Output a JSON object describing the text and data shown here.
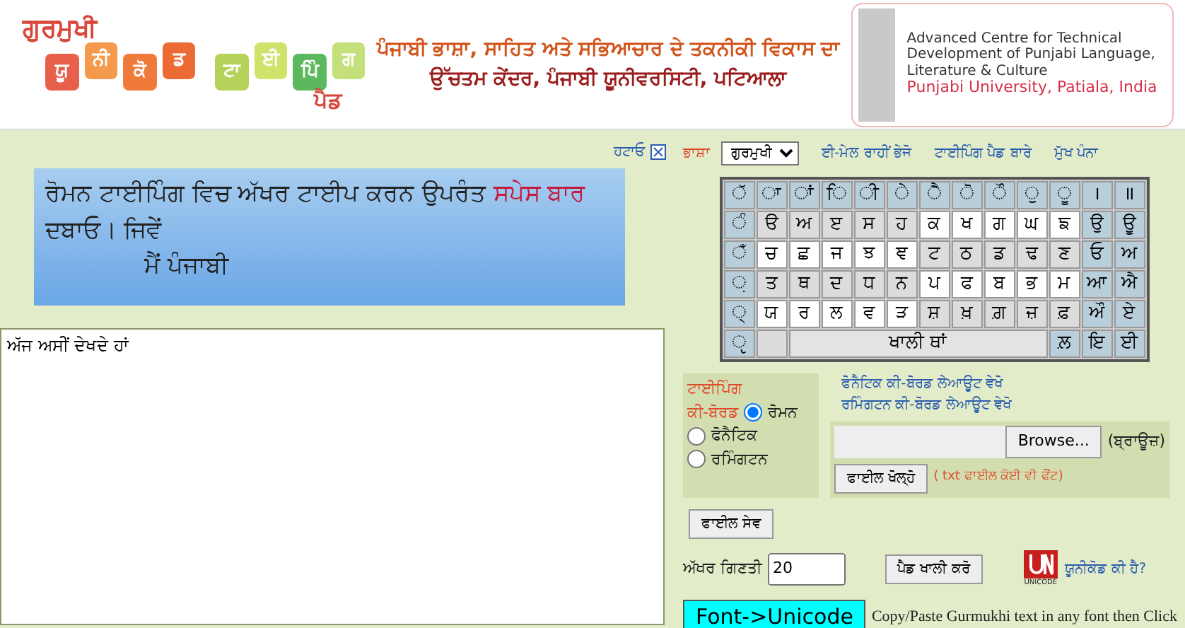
{
  "header": {
    "logo_title": "ਗੁਰਮੁਖੀ",
    "logo_tiles": [
      {
        "label": "ਯੂ",
        "color": "#e8604c"
      },
      {
        "label": "ਨੀ",
        "color": "#f39a4c"
      },
      {
        "label": "ਕੋ",
        "color": "#f07a3a"
      },
      {
        "label": "ਡ",
        "color": "#ec6a34"
      },
      {
        "label": "ਟਾ",
        "color": "#b5d35a"
      },
      {
        "label": "ਈ",
        "color": "#cfe36a"
      },
      {
        "label": "ਪਿੰ",
        "color": "#5cb85c"
      },
      {
        "label": "ਗ",
        "color": "#c4e07a"
      }
    ],
    "logo_subtitle": "ਪੈਡ",
    "tagline": [
      "ਪੰਜਾਬੀ ਭਾਸ਼ਾ, ਸਾਹਿਤ ਅਤੇ ਸਭਿਆਚਾਰ ਦੇ ਤਕਨੀਕੀ ਵਿਕਾਸ ਦਾ",
      "ਉੱਚਤਮ ਕੇਂਦਰ, ਪੰਜਾਬੀ ਯੂਨੀਵਰਸਿਟੀ, ਪਟਿਆਲਾ"
    ],
    "centre": {
      "name": "Advanced Centre for Technical Development of Punjabi Language, Literature & Culture",
      "university": "Punjabi University, Patiala, India"
    }
  },
  "remove_link": "ਹਟਾਓ",
  "banner": {
    "text": "ਰੋਮਨ ਟਾਈਪਿੰਗ ਵਿਚ ਅੱਖਰ ਟਾਈਪ ਕਰਨ ਉਪਰੰਤ",
    "highlight": "ਸਪੇਸ ਬਾਰ",
    "text_end": "ਦਬਾਓ। ਜਿਵੇਂ",
    "example": "ਮੈਂ ਪੰਜਾਬੀ"
  },
  "editor": {
    "value": "ਅੱਜ ਅਸੀਂ ਦੇਖਦੇ ਹਾਂ"
  },
  "language": {
    "label": "ਭਾਸ਼ਾ",
    "value": "ਗੁਰਮੁਖੀ"
  },
  "nav_links": [
    "ਈ-ਮੇਲ ਰਾਹੀਂ ਭੇਜੋ",
    "ਟਾਈਪਿੰਗ ਪੈਡ ਬਾਰੇ",
    "ਮੁੱਖ ਪੰਨਾ"
  ],
  "keyboard": [
    [
      {
        "label": "ੱ",
        "kind": "sign"
      },
      {
        "label": "ਾ",
        "kind": "sign"
      },
      {
        "label": "ਾਂ",
        "kind": "sign"
      },
      {
        "label": "ਿ",
        "kind": "sign"
      },
      {
        "label": "ੀ",
        "kind": "sign"
      },
      {
        "label": "ੇ",
        "kind": "sign"
      },
      {
        "label": "ੈ",
        "kind": "sign"
      },
      {
        "label": "ੋ",
        "kind": "sign"
      },
      {
        "label": "ੌ",
        "kind": "sign"
      },
      {
        "label": "ੁ",
        "kind": "sign"
      },
      {
        "label": "ੂ",
        "kind": "sign"
      },
      {
        "label": "।",
        "kind": "sign"
      },
      {
        "label": "॥",
        "kind": "sign"
      }
    ],
    [
      {
        "label": "ੰ",
        "kind": "sign"
      },
      {
        "label": "ੳ",
        "kind": "shaded"
      },
      {
        "label": "ਅ",
        "kind": "shaded"
      },
      {
        "label": "ੲ",
        "kind": "shaded"
      },
      {
        "label": "ਸ",
        "kind": "shaded"
      },
      {
        "label": "ਹ",
        "kind": "shaded"
      },
      {
        "label": "ਕ",
        "kind": "plain"
      },
      {
        "label": "ਖ",
        "kind": "plain"
      },
      {
        "label": "ਗ",
        "kind": "plain"
      },
      {
        "label": "ਘ",
        "kind": "plain"
      },
      {
        "label": "ਙ",
        "kind": "plain"
      },
      {
        "label": "ਉ",
        "kind": "sign"
      },
      {
        "label": "ਊ",
        "kind": "sign"
      }
    ],
    [
      {
        "label": "ਁ",
        "kind": "sign"
      },
      {
        "label": "ਚ",
        "kind": "plain"
      },
      {
        "label": "ਛ",
        "kind": "plain"
      },
      {
        "label": "ਜ",
        "kind": "plain"
      },
      {
        "label": "ਝ",
        "kind": "plain"
      },
      {
        "label": "ਞ",
        "kind": "plain"
      },
      {
        "label": "ਟ",
        "kind": "shaded"
      },
      {
        "label": "ਠ",
        "kind": "shaded"
      },
      {
        "label": "ਡ",
        "kind": "shaded"
      },
      {
        "label": "ਢ",
        "kind": "shaded"
      },
      {
        "label": "ਣ",
        "kind": "shaded"
      },
      {
        "label": "ਓ",
        "kind": "sign"
      },
      {
        "label": "ਅ",
        "kind": "sign"
      }
    ],
    [
      {
        "label": "਼",
        "kind": "sign"
      },
      {
        "label": "ਤ",
        "kind": "shaded"
      },
      {
        "label": "ਥ",
        "kind": "shaded"
      },
      {
        "label": "ਦ",
        "kind": "shaded"
      },
      {
        "label": "ਧ",
        "kind": "shaded"
      },
      {
        "label": "ਨ",
        "kind": "shaded"
      },
      {
        "label": "ਪ",
        "kind": "plain"
      },
      {
        "label": "ਫ",
        "kind": "plain"
      },
      {
        "label": "ਬ",
        "kind": "plain"
      },
      {
        "label": "ਭ",
        "kind": "plain"
      },
      {
        "label": "ਮ",
        "kind": "plain"
      },
      {
        "label": "ਆ",
        "kind": "sign"
      },
      {
        "label": "ਐ",
        "kind": "sign"
      }
    ],
    [
      {
        "label": "੍",
        "kind": "sign"
      },
      {
        "label": "ਯ",
        "kind": "plain"
      },
      {
        "label": "ਰ",
        "kind": "plain"
      },
      {
        "label": "ਲ",
        "kind": "plain"
      },
      {
        "label": "ਵ",
        "kind": "plain"
      },
      {
        "label": "ੜ",
        "kind": "plain"
      },
      {
        "label": "ਸ਼",
        "kind": "shaded"
      },
      {
        "label": "ਖ਼",
        "kind": "shaded"
      },
      {
        "label": "ਗ਼",
        "kind": "shaded"
      },
      {
        "label": "ਜ਼",
        "kind": "shaded"
      },
      {
        "label": "ਫ਼",
        "kind": "shaded"
      },
      {
        "label": "ਔ",
        "kind": "sign"
      },
      {
        "label": "ਏ",
        "kind": "sign"
      }
    ],
    [
      {
        "label": "ੵ",
        "kind": "sign"
      },
      {
        "kind": "blank"
      },
      {
        "label": "ਖਾਲੀ ਥਾਂ",
        "kind": "space"
      },
      {
        "label": "ਲ਼",
        "kind": "sign"
      },
      {
        "label": "ਇ",
        "kind": "sign"
      },
      {
        "label": "ਈ",
        "kind": "sign"
      }
    ]
  ],
  "typing": {
    "label": "ਟਾਈਪਿੰਗ",
    "label2": "ਕੀ-ਬੋਰਡ",
    "options": [
      {
        "label": "ਰੋਮਨ",
        "selected": true
      },
      {
        "label": "ਫੋਨੈਟਿਕ",
        "selected": false
      },
      {
        "label": "ਰਮਿੰਗਟਨ",
        "selected": false
      }
    ]
  },
  "layout_links": [
    "ਫੋਨੈਟਿਕ ਕੀ-ਬੋਰਡ ਲੇਆਊਟ ਵੇਖੋ",
    "ਰਮਿੰਗਟਨ ਕੀ-ਬੋਰਡ ਲੇਆਊਟ ਵੇਖੋ"
  ],
  "file": {
    "browse": "Browse...",
    "browse_note": "(ਬ੍ਰਾਊਜ਼)",
    "open": "ਫਾਈਲ ਖੋਲ੍ਹੋ",
    "open_note": "( txt ਫਾਈਲ ਕੋਈ ਵੀ ਫੌਂਟ)",
    "save": "ਫਾਈਲ ਸੇਵ"
  },
  "word_count": {
    "label": "ਅੱਖਰ ਗਿਣਤੀ",
    "value": "20"
  },
  "clear": "ਪੈਡ ਖਾਲੀ ਕਰੋ",
  "unicode": {
    "logo_caption": "UNICODE",
    "link": "ਯੂਨੀਕੋਡ ਕੀ ਹੈ?"
  },
  "convert": {
    "button": "Font->Unicode",
    "note": "Copy/Paste Gurmukhi text in any font then Click"
  }
}
